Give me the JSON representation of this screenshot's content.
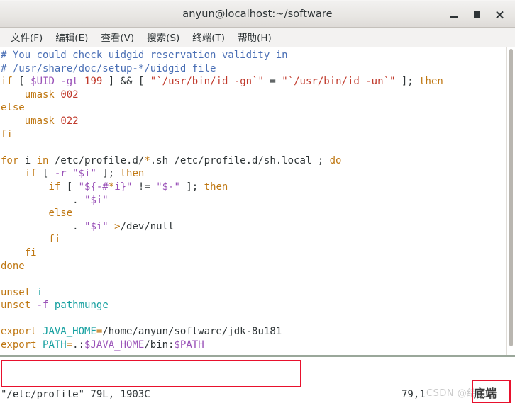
{
  "window": {
    "title": "anyun@localhost:~/software",
    "buttons": [
      {
        "name": "minimize",
        "label": "–"
      },
      {
        "name": "maximize",
        "label": "□"
      },
      {
        "name": "close",
        "label": "×"
      }
    ]
  },
  "menubar": {
    "items": [
      {
        "label": "文件(F)"
      },
      {
        "label": "编辑(E)"
      },
      {
        "label": "查看(V)"
      },
      {
        "label": "搜索(S)"
      },
      {
        "label": "终端(T)"
      },
      {
        "label": "帮助(H)"
      }
    ]
  },
  "terminal": {
    "lines": [
      {
        "text": "# You could check uidgid reservation validity in"
      },
      {
        "text": "# /usr/share/doc/setup-*/uidgid file"
      },
      {
        "text": "if [ $UID -gt 199 ] && [ \"`/usr/bin/id -gn`\" = \"`/usr/bin/id -un`\" ]; then"
      },
      {
        "text": "    umask 002"
      },
      {
        "text": "else"
      },
      {
        "text": "    umask 022"
      },
      {
        "text": "fi"
      },
      {
        "text": ""
      },
      {
        "text": "for i in /etc/profile.d/*.sh /etc/profile.d/sh.local ; do"
      },
      {
        "text": "    if [ -r \"$i\" ]; then"
      },
      {
        "text": "        if [ \"${-#*i}\" != \"$-\" ]; then"
      },
      {
        "text": "            . \"$i\""
      },
      {
        "text": "        else"
      },
      {
        "text": "            . \"$i\" >/dev/null"
      },
      {
        "text": "        fi"
      },
      {
        "text": "    fi"
      },
      {
        "text": "done"
      },
      {
        "text": ""
      },
      {
        "text": "unset i"
      },
      {
        "text": "unset -f pathmunge"
      },
      {
        "text": ""
      },
      {
        "text": "export JAVA_HOME=/home/anyun/software/jdk-8u181"
      },
      {
        "text": "export PATH=.:$JAVA_HOME/bin:$PATH"
      }
    ],
    "status_line": "\"/etc/profile\" 79L, 1903C",
    "cursor_position": "79,1"
  },
  "annotations": {
    "export_box_color": "#e8112d",
    "bottom_label": "底端",
    "watermark": "CSDN @结实蘑"
  },
  "colors": {
    "comment": "#4a6fb5",
    "keyword": "#bf7712",
    "variable": "#9a52b8",
    "number": "#c0392b",
    "string": "#c0392b",
    "identifier": "#16a0a0",
    "plain": "#2e3436",
    "annotation_red": "#e8112d"
  }
}
